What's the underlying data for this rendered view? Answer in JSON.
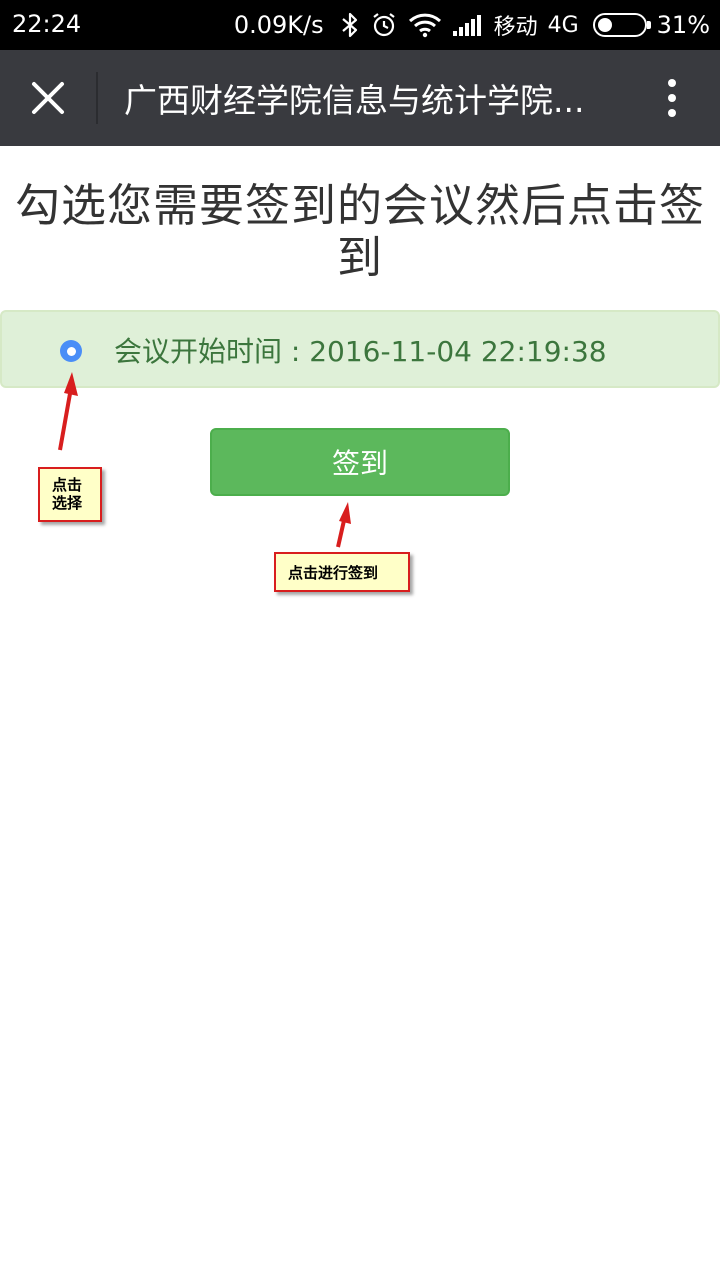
{
  "status_bar": {
    "time": "22:24",
    "net_speed": "0.09K/s",
    "carrier": "移动",
    "network_type": "4G",
    "battery_percent": "31%",
    "battery_level": 0.31,
    "icons": [
      "bluetooth-icon",
      "alarm-icon",
      "wifi-icon",
      "signal-icon",
      "battery-icon"
    ]
  },
  "header": {
    "title": "广西财经学院信息与统计学院..."
  },
  "main": {
    "heading": "勾选您需要签到的会议然后点击签到",
    "meeting": {
      "label": "会议开始时间 : 2016-11-04 22:19:38",
      "selected": true
    },
    "signin_button": "签到"
  },
  "annotations": {
    "select_line1": "点击",
    "select_line2": "选择",
    "signin_note": "点击进行签到"
  },
  "colors": {
    "status_bar_bg": "#000000",
    "header_bg": "#393a3f",
    "success_bg": "#dff0d8",
    "success_text": "#3c763d",
    "button_green": "#5cb85c",
    "radio_blue": "#4a8ef7",
    "annotation_red": "#d81e1e",
    "annotation_bg": "#ffffc8"
  }
}
